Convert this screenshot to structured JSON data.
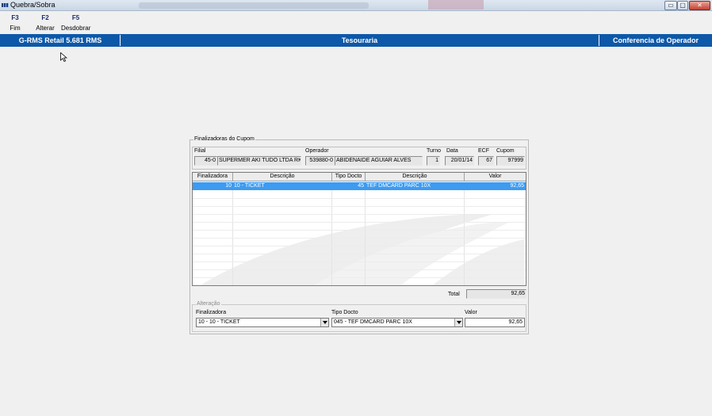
{
  "window": {
    "title": "Quebra/Sobra",
    "buttons": {
      "minimize": "▭",
      "restore": "▢",
      "close": "✕"
    }
  },
  "toolbar": [
    {
      "key": "F3",
      "label": "Fim"
    },
    {
      "key": "F2",
      "label": "Alterar"
    },
    {
      "key": "F5",
      "label": "Desdobrar"
    }
  ],
  "header_bar": {
    "left": "G-RMS Retail 5.681 RMS",
    "center": "Tesouraria",
    "right": "Conferencia de Operador"
  },
  "panel": {
    "legend": "Finalizadoras do Cupom",
    "labels": {
      "filial": "Filial",
      "operador": "Operador",
      "turno": "Turno",
      "data": "Data",
      "ecf": "ECF",
      "cupom": "Cupom"
    },
    "values": {
      "filial_code": "45-0",
      "filial_name": "SUPERMER AKI TUDO LTDA RK",
      "operador_code": "539880-0",
      "operador_name": "ABIDENAIDE AGUIAR ALVES",
      "turno": "1",
      "data": "20/01/14",
      "ecf": "67",
      "cupom": "97999"
    },
    "grid": {
      "columns": [
        "Finalizadora",
        "Descrição",
        "Tipo Docto",
        "Descrição",
        "Valor"
      ],
      "rows": [
        {
          "finalizadora": "10",
          "descricao": "10 - TICKET",
          "tipo_docto": "45",
          "descricao2": "TEF DMCARD PARC 10X",
          "valor": "92,65"
        }
      ]
    },
    "total": {
      "label": "Total",
      "value": "92,65"
    },
    "alteracao": {
      "legend": "Alteração",
      "labels": {
        "finalizadora": "Finalizadora",
        "tipo_docto": "Tipo Docto",
        "valor": "Valor"
      },
      "finalizadora": "10 - 10 - TICKET",
      "tipo_docto": "045 - TEF DMCARD PARC 10X",
      "valor": "92,65"
    }
  }
}
